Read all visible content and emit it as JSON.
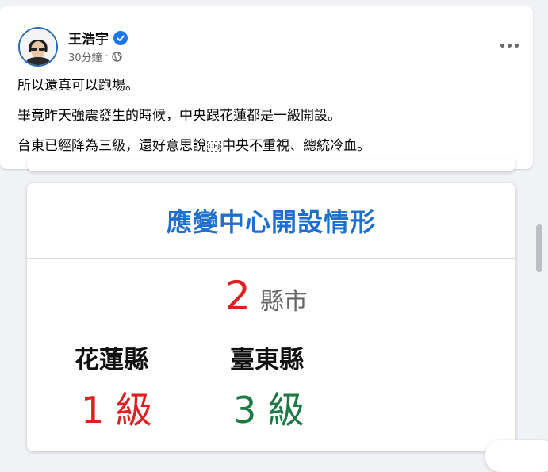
{
  "post": {
    "author": "王浩宇",
    "timestamp": "30分鐘",
    "separator": "·",
    "privacy_icon": "globe-icon",
    "verified_icon": "verified-badge-icon",
    "more_icon": "more-options-icon",
    "lines": [
      "所以還真可以跑場。",
      "畢竟昨天強震發生的時候，中央跟花蓮都是一級開設。"
    ],
    "line3_before": "台東已經降為三級，還好意思說",
    "line3_obj": "OBJ",
    "line3_after": "中央不重視、總統冷血。"
  },
  "card": {
    "title": "應變中心開設情形",
    "count": "2",
    "count_unit": "縣市",
    "counties": [
      {
        "name": "花蓮縣",
        "level": "1 級",
        "color": "#e02020"
      },
      {
        "name": "臺東縣",
        "level": "3 級",
        "color": "#1e7a44"
      }
    ]
  },
  "colors": {
    "accent_blue": "#1f6fd1",
    "verified_blue": "#1877f2",
    "level_red": "#e02020",
    "level_green": "#1e7a44"
  }
}
